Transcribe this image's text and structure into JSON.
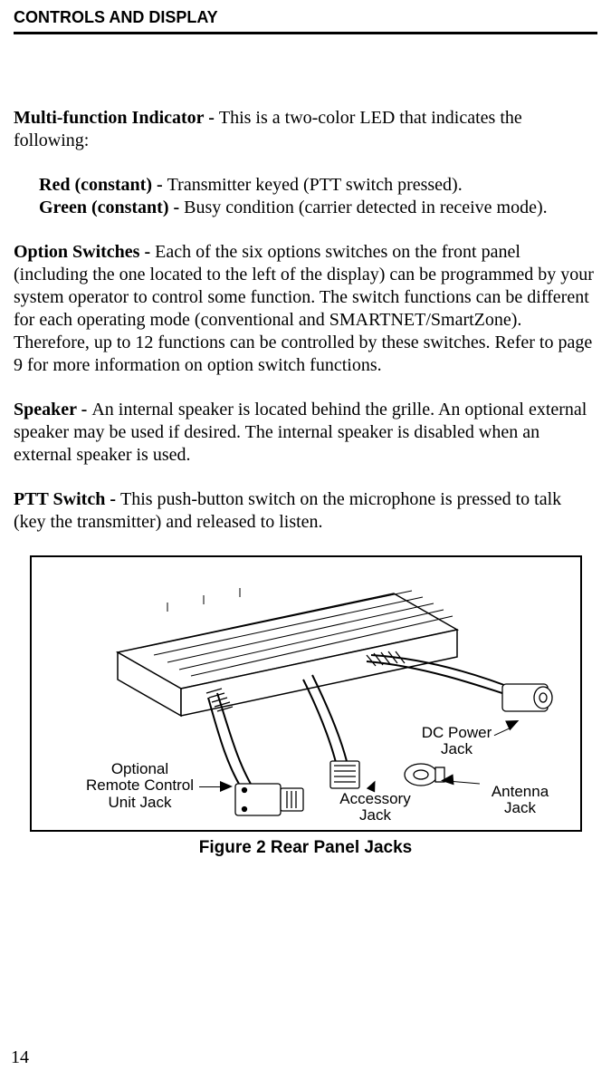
{
  "header": "CONTROLS AND DISPLAY",
  "p1_label": "Multi-function Indicator - ",
  "p1_body": "This is a two-color LED that indicates the following:",
  "red_label": "Red (constant) - ",
  "red_body": "Transmitter keyed (PTT switch pressed).",
  "green_label": "Green (constant) - ",
  "green_body": "Busy condition (carrier detected in receive mode).",
  "p2_label": "Option Switches - ",
  "p2_body": "Each of the six options switches on the front panel (including the one located to the left of the display) can be programmed by your system operator to control some function. The switch functions can be different for each operating mode (conventional and SMARTNET/SmartZone). Therefore, up to 12 functions can be controlled by these switches. Refer to page 9 for more information on option switch functions.",
  "p3_label": "Speaker - ",
  "p3_body": "An internal speaker is located behind the grille. An optional external speaker may be used if desired. The internal speaker is disabled when an external speaker is used.",
  "p4_label": "PTT Switch - ",
  "p4_body": "This push-button switch on the microphone is pressed to talk (key the transmitter) and released to listen.",
  "fig": {
    "dc_power": "DC Power\nJack",
    "antenna": "Antenna\nJack",
    "accessory": "Accessory\nJack",
    "remote": "Optional\nRemote Control\nUnit Jack"
  },
  "caption": "Figure 2  Rear Panel Jacks",
  "page_number": "14"
}
